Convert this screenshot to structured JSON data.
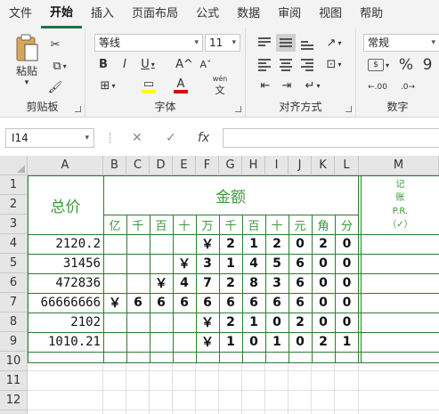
{
  "ribbon_tabs": [
    "文件",
    "开始",
    "插入",
    "页面布局",
    "公式",
    "数据",
    "审阅",
    "视图",
    "帮助"
  ],
  "clipboard": {
    "paste_label": "粘贴",
    "group_label": "剪贴板"
  },
  "font": {
    "name": "等线",
    "size": "11",
    "bold": "B",
    "italic": "I",
    "underline": "U",
    "grow": "A^",
    "shrink": "Aˇ",
    "fill_glyph": "▭",
    "color_glyph": "A",
    "wen": "wén",
    "wen_char": "文",
    "group_label": "字体"
  },
  "alignment": {
    "group_label": "对齐方式"
  },
  "number": {
    "format": "常规",
    "currency": "$",
    "percent": "%",
    "comma": "9",
    "inc_decimal": ".00",
    "dec_decimal": ".0",
    "group_label": "数字"
  },
  "formula_bar": {
    "name_box": "I14",
    "cancel": "✕",
    "enter": "✓",
    "fx": "fx",
    "value": ""
  },
  "columns": [
    "A",
    "B",
    "C",
    "D",
    "E",
    "F",
    "G",
    "H",
    "I",
    "J",
    "K",
    "L",
    "M"
  ],
  "rows": [
    "1",
    "2",
    "3",
    "4",
    "5",
    "6",
    "7",
    "8",
    "9",
    "10",
    "11",
    "12",
    "13"
  ],
  "sheet": {
    "total_header": "总价",
    "amount_header": "金额",
    "ledger_header": [
      "记",
      "账",
      "P.R.",
      "（✓）"
    ],
    "units": [
      "亿",
      "千",
      "百",
      "十",
      "万",
      "千",
      "百",
      "十",
      "元",
      "角",
      "分"
    ],
    "totals": [
      "2120.2",
      "31456",
      "472836",
      "66666666",
      "2102",
      "1010.21"
    ],
    "digits": [
      [
        "",
        "",
        "",
        "",
        "￥",
        "2",
        "1",
        "2",
        "0",
        "2",
        "0"
      ],
      [
        "",
        "",
        "",
        "￥",
        "3",
        "1",
        "4",
        "5",
        "6",
        "0",
        "0"
      ],
      [
        "",
        "",
        "￥",
        "4",
        "7",
        "2",
        "8",
        "3",
        "6",
        "0",
        "0"
      ],
      [
        "￥",
        "6",
        "6",
        "6",
        "6",
        "6",
        "6",
        "6",
        "6",
        "0",
        "0"
      ],
      [
        "",
        "",
        "",
        "",
        "￥",
        "2",
        "1",
        "0",
        "2",
        "0",
        "0"
      ],
      [
        "",
        "",
        "",
        "",
        "￥",
        "1",
        "0",
        "1",
        "0",
        "2",
        "1"
      ]
    ]
  },
  "colors": {
    "accent": "#217346",
    "table_border": "#2e7d32",
    "header_text": "#3a9a3a"
  }
}
